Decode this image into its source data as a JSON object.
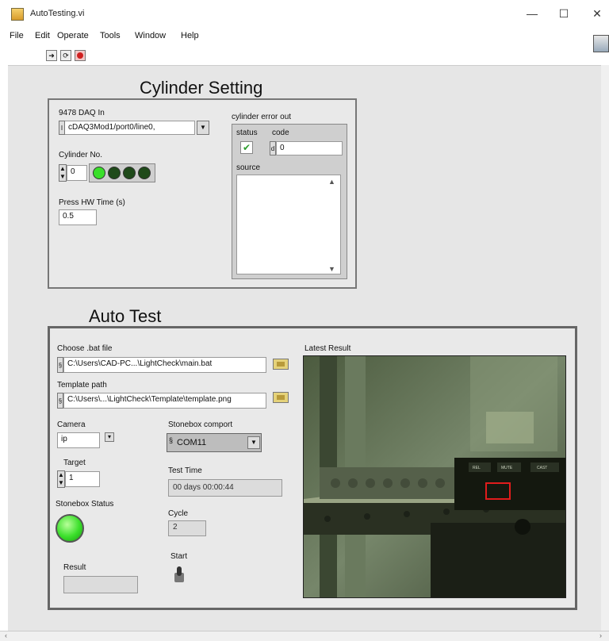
{
  "window": {
    "title": "AutoTesting.vi",
    "minimize": "—",
    "maximize": "☐",
    "close": "✕"
  },
  "menu": [
    "File",
    "Edit",
    "Operate",
    "Tools",
    "Window",
    "Help"
  ],
  "toolbar": {
    "icons": [
      "run-arrow-icon",
      "run-continuous-icon",
      "abort-icon"
    ]
  },
  "cylinder": {
    "heading": "Cylinder Setting",
    "daq_label": "9478 DAQ In",
    "daq_value": "cDAQ3Mod1/port0/line0,",
    "cylinder_no_label": "Cylinder No.",
    "cylinder_no_value": "0",
    "press_label": "Press HW  Time (s)",
    "press_value": "0.5",
    "leds_on": [
      true,
      false,
      false,
      false
    ]
  },
  "error_cluster": {
    "label": "cylinder error out",
    "status_label": "status",
    "code_label": "code",
    "code_value": "0",
    "source_label": "source",
    "source_value": ""
  },
  "auto_test": {
    "heading": "Auto Test",
    "bat_label": "Choose .bat file",
    "bat_value": "C:\\Users\\CAD-PC...\\LightCheck\\main.bat",
    "template_label": "Template path",
    "template_value": "C:\\Users\\...\\LightCheck\\Template\\template.png",
    "camera_label": "Camera",
    "camera_value": "ip",
    "target_label": "Target",
    "target_value": "1",
    "stonebox_status_label": "Stonebox Status",
    "result_label": "Result",
    "result_value": "",
    "comport_label": "Stonebox comport",
    "comport_value": "COM11",
    "test_time_label": "Test Time",
    "test_time_value": "00 days 00:00:44",
    "cycle_label": "Cycle",
    "cycle_value": "2",
    "start_label": "Start",
    "latest_result_label": "Latest Result",
    "camera_buttons": [
      "REL",
      "MUTE",
      "CAST"
    ]
  },
  "colors": {
    "led_on": "#3adf2a",
    "led_off": "#1f4a1a",
    "status_ok": "#2e9e2e",
    "camera_bg": "#5a6a4c",
    "highlight_box": "#e01c1c"
  }
}
